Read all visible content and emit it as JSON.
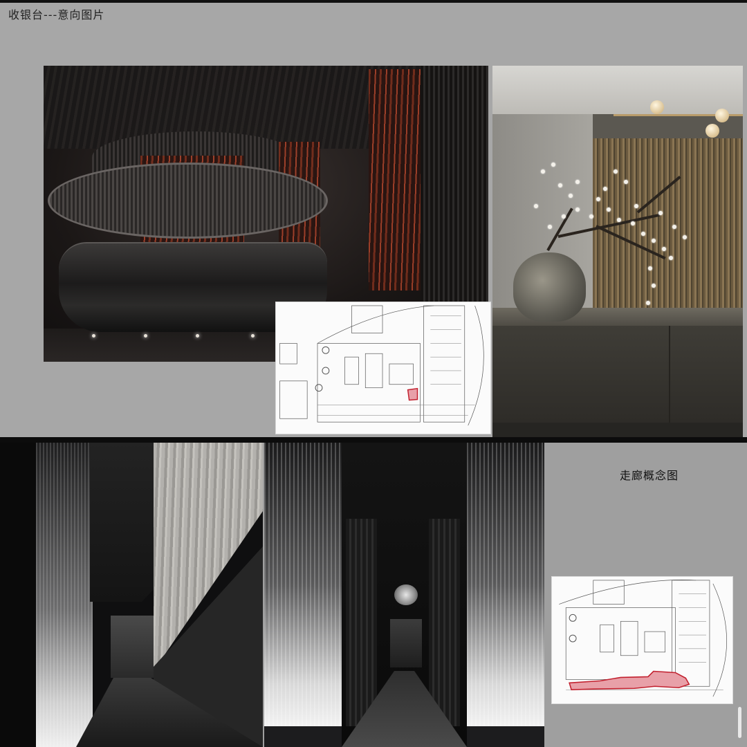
{
  "page": {
    "heading": "收银台---意向图片",
    "corridor_caption": "走廊概念图"
  },
  "images": {
    "cashier_desk": "cashier-desk-photo",
    "plum_vase": "plum-blossom-vase-photo",
    "corridor_a": "waterfall-corridor-photo",
    "corridor_b": "dark-corridor-photo"
  },
  "colors": {
    "highlight": "#e8a0a8",
    "highlight_stroke": "#c2202e"
  }
}
